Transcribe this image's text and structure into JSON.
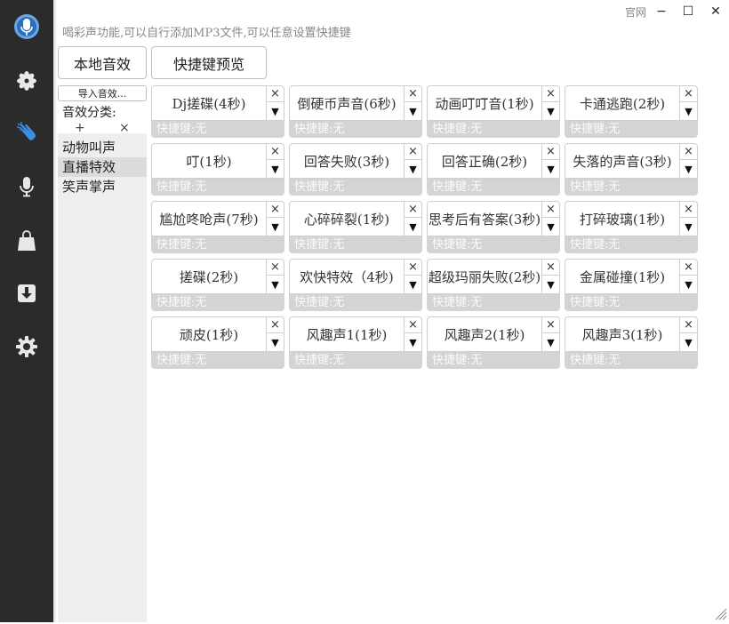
{
  "window": {
    "official_link": "官网",
    "minimize": "−",
    "maximize": "☐",
    "close": "✕"
  },
  "description": "喝彩声功能,可以自行添加MP3文件,可以任意设置快捷键",
  "tabs": {
    "local": "本地音效",
    "hotkey": "快捷键预览"
  },
  "left": {
    "import_label": "导入音效...",
    "category_label": "音效分类:",
    "add_symbol": "+",
    "delete_symbol": "×",
    "categories": [
      "动物叫声",
      "直播特效",
      "笑声掌声"
    ],
    "selected_index": 1
  },
  "card_controls": {
    "close": "×",
    "dropdown": "▼"
  },
  "sounds": [
    {
      "name": "Dj搓碟(4秒)",
      "hotkey": "快捷键:无"
    },
    {
      "name": "倒硬币声音(6秒)",
      "hotkey": "快捷键:无"
    },
    {
      "name": "动画叮叮音(1秒)",
      "hotkey": "快捷键:无"
    },
    {
      "name": "卡通逃跑(2秒)",
      "hotkey": "快捷键:无"
    },
    {
      "name": "叮(1秒)",
      "hotkey": "快捷键:无"
    },
    {
      "name": "回答失败(3秒)",
      "hotkey": "快捷键:无"
    },
    {
      "name": "回答正确(2秒)",
      "hotkey": "快捷键:无"
    },
    {
      "name": "失落的声音(3秒)",
      "hotkey": "快捷键:无"
    },
    {
      "name": "尴尬咚呛声(7秒)",
      "hotkey": "快捷键:无"
    },
    {
      "name": "心碎碎裂(1秒)",
      "hotkey": "快捷键:无"
    },
    {
      "name": "思考后有答案(3秒)",
      "hotkey": "快捷键:无"
    },
    {
      "name": "打碎玻璃(1秒)",
      "hotkey": "快捷键:无"
    },
    {
      "name": "搓碟(2秒)",
      "hotkey": "快捷键:无"
    },
    {
      "name": "欢快特效（4秒)",
      "hotkey": "快捷键:无"
    },
    {
      "name": "超级玛丽失败(2秒)",
      "hotkey": "快捷键:无"
    },
    {
      "name": "金属碰撞(1秒)",
      "hotkey": "快捷键:无"
    },
    {
      "name": "顽皮(1秒)",
      "hotkey": "快捷键:无"
    },
    {
      "name": "风趣声1(1秒)",
      "hotkey": "快捷键:无"
    },
    {
      "name": "风趣声2(1秒)",
      "hotkey": "快捷键:无"
    },
    {
      "name": "风趣声3(1秒)",
      "hotkey": "快捷键:无"
    }
  ],
  "sidebar_icons": [
    "microphone-logo-icon",
    "flower-icon",
    "clapping-hands-icon",
    "microphone-icon",
    "shopping-bag-icon",
    "download-icon",
    "settings-gear-icon"
  ],
  "colors": {
    "sidebar": "#2b2b2b",
    "accent_blue": "#3b8fe0",
    "card_footer": "#d4d4d4"
  }
}
